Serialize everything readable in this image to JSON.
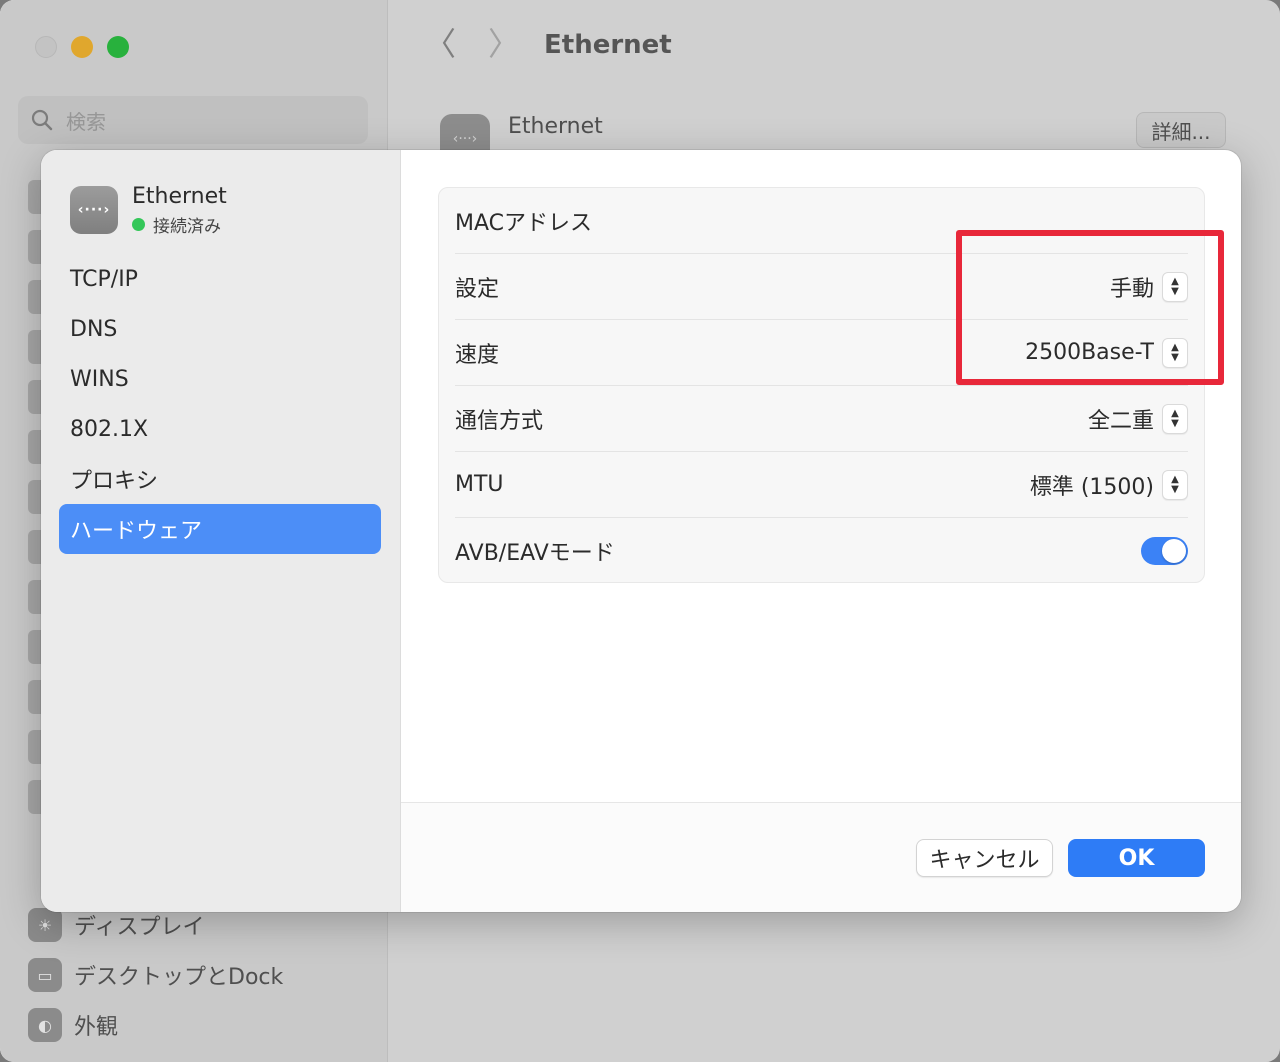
{
  "background": {
    "search_placeholder": "検索",
    "toolbar_title": "Ethernet",
    "header_label": "Ethernet",
    "detail_button": "詳細...",
    "sidebar_items": [
      {
        "label": "ディスプレイ",
        "icon": "display-icon"
      },
      {
        "label": "デスクトップとDock",
        "icon": "desktop-dock-icon"
      },
      {
        "label": "外観",
        "icon": "appearance-icon"
      }
    ]
  },
  "sheet": {
    "interface": {
      "name": "Ethernet",
      "status": "接続済み",
      "status_color": "#34c759",
      "icon": "ethernet-icon"
    },
    "nav": [
      "TCP/IP",
      "DNS",
      "WINS",
      "802.1X",
      "プロキシ",
      "ハードウェア"
    ],
    "selected_nav": "ハードウェア",
    "rows": [
      {
        "label": "MACアドレス",
        "value": ""
      },
      {
        "label": "設定",
        "value": "手動"
      },
      {
        "label": "速度",
        "value": "2500Base-T"
      },
      {
        "label": "通信方式",
        "value": "全二重"
      },
      {
        "label": "MTU",
        "value": "標準 (1500)"
      },
      {
        "label": "AVB/EAVモード",
        "toggle": true
      }
    ],
    "buttons": {
      "cancel": "キャンセル",
      "ok": "OK"
    },
    "accent_color": "#2e7cf6",
    "highlight_color": "#e8283a"
  }
}
